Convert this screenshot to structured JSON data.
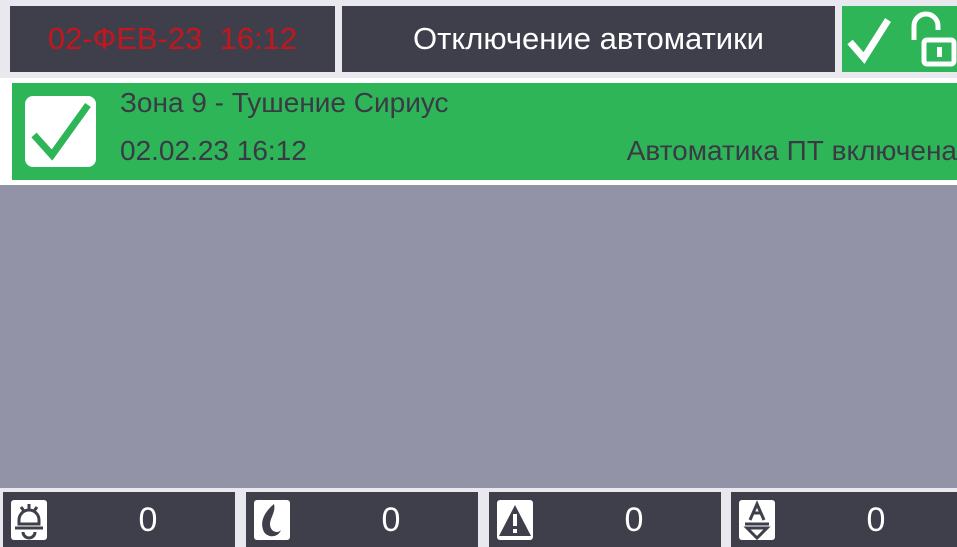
{
  "header": {
    "datetime": "02-ФЕВ-23  16:12",
    "title": "Отключение автоматики",
    "status_icons": [
      "check-icon",
      "unlock-icon"
    ],
    "status_color": "#2eb557",
    "datetime_color": "#c4161c"
  },
  "event": {
    "zone": "Зона 9 - Тушение Сириус",
    "timestamp": "02.02.23 16:12",
    "state": "Автоматика ПТ включена",
    "icon": "check-icon",
    "color": "#2eb557"
  },
  "counters": [
    {
      "icon": "fire-alarm-bell-icon",
      "value": "0"
    },
    {
      "icon": "flame-icon",
      "value": "0"
    },
    {
      "icon": "warning-triangle-icon",
      "value": "0"
    },
    {
      "icon": "automation-icon",
      "value": "0"
    }
  ]
}
